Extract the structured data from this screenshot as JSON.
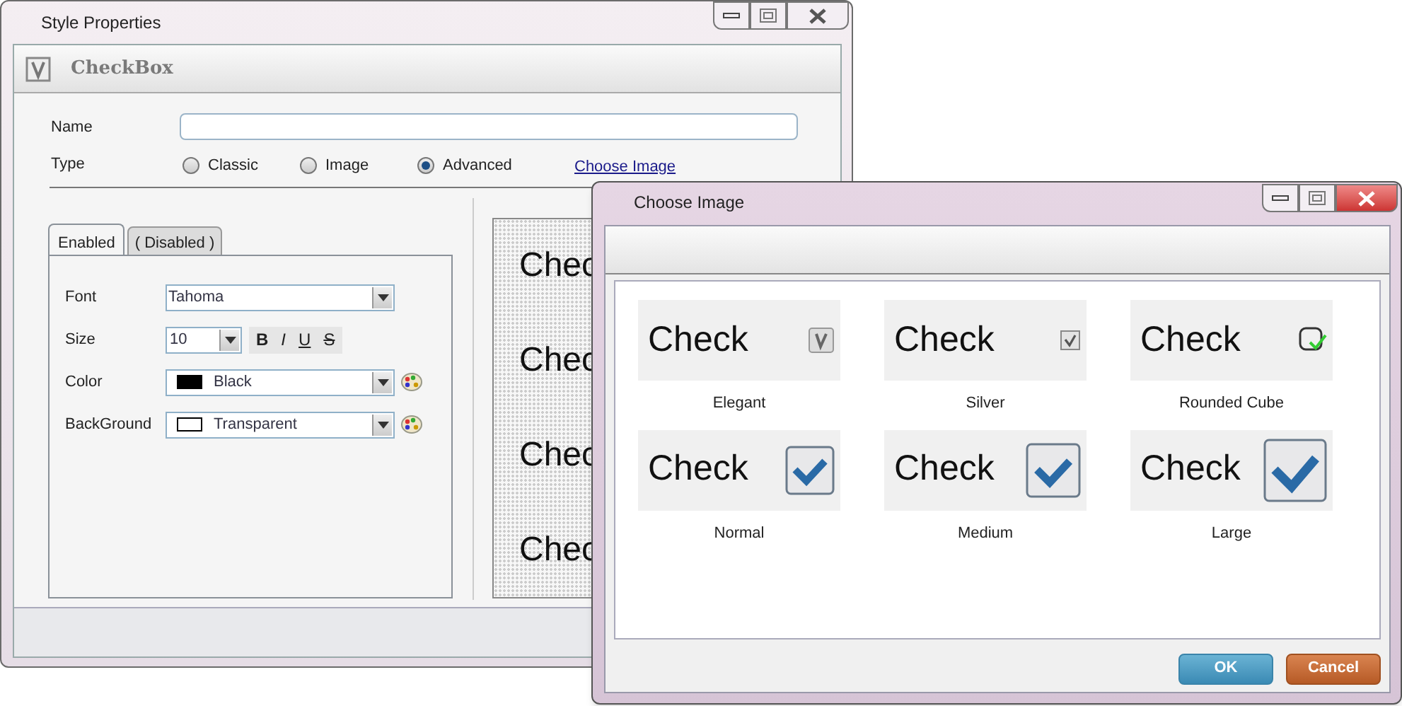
{
  "main_window": {
    "title": "Style Properties",
    "header": "CheckBox",
    "name_label": "Name",
    "type_label": "Type",
    "type_options": [
      {
        "label": "Classic",
        "selected": false
      },
      {
        "label": "Image",
        "selected": false
      },
      {
        "label": "Advanced",
        "selected": true
      }
    ],
    "choose_image_link": "Choose Image",
    "tabs": [
      {
        "label": "Enabled",
        "selected": true
      },
      {
        "label": "( Disabled )",
        "selected": false
      }
    ],
    "properties": [
      {
        "kind": "combo",
        "label": "Font",
        "value": "Tahoma"
      },
      {
        "kind": "size",
        "label": "Size",
        "value": "10",
        "format_buttons": [
          "B",
          "I",
          "U",
          "S"
        ]
      },
      {
        "kind": "color",
        "label": "Color",
        "value": "Black",
        "color": "#000000"
      },
      {
        "kind": "color",
        "label": "BackGround",
        "value": "Transparent",
        "color": "#ffffff"
      }
    ],
    "preview": [
      "Chec",
      "Chec",
      "Chec",
      "Chec"
    ]
  },
  "dialog": {
    "title": "Choose Image",
    "styles": [
      {
        "kind": "elegant",
        "preview_text": "Check",
        "label": "Elegant"
      },
      {
        "kind": "silver",
        "preview_text": "Check",
        "label": "Silver"
      },
      {
        "kind": "rounded",
        "preview_text": "Check",
        "label": "Rounded Cube"
      },
      {
        "kind": "normal",
        "preview_text": "Check",
        "label": "Normal"
      },
      {
        "kind": "medium",
        "preview_text": "Check",
        "label": "Medium"
      },
      {
        "kind": "large",
        "preview_text": "Check",
        "label": "Large"
      }
    ],
    "buttons": [
      "OK",
      "Cancel"
    ]
  }
}
